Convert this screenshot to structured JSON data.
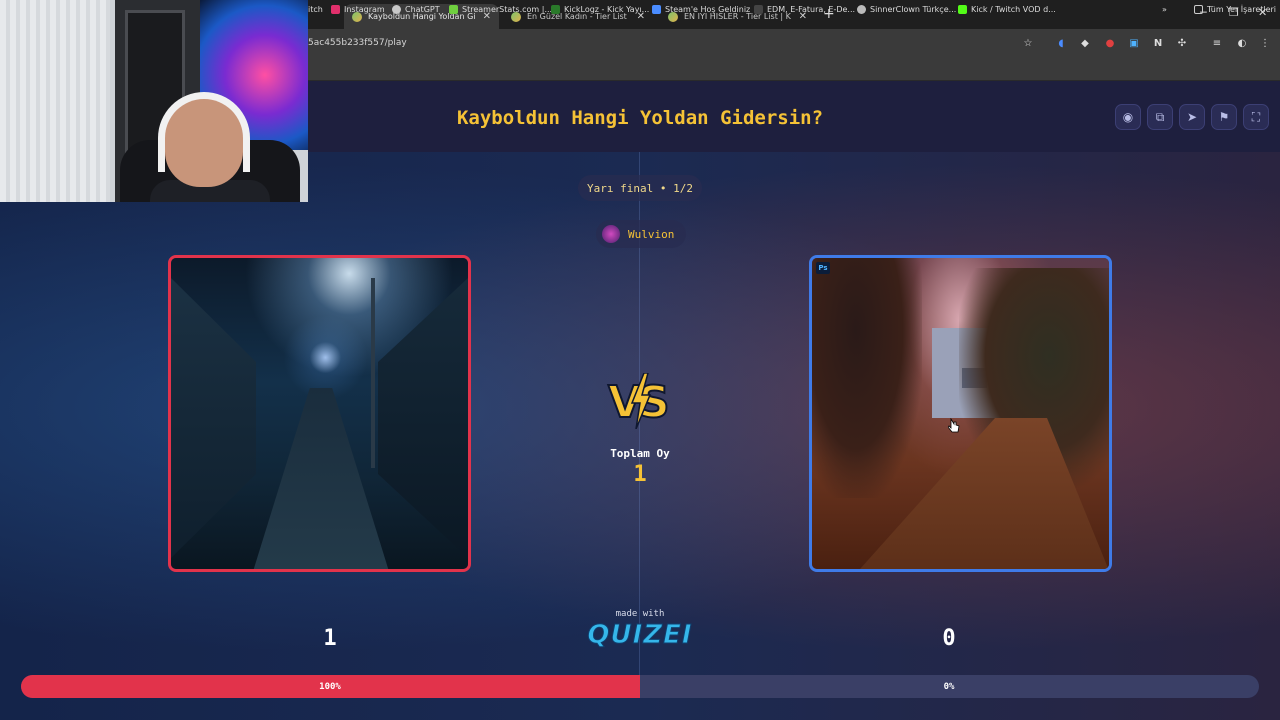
{
  "browser": {
    "tabs": [
      {
        "label": "Kayboldun Hangi Yoldan Giders",
        "active": true
      },
      {
        "label": "En Güzel Kadın - Tier List | Kör S",
        "active": false
      },
      {
        "label": "EN IYI HISLER - Tier List | Kör Sı",
        "active": false
      }
    ],
    "url": "5ac455b233f557/play",
    "bookmarks": [
      "itch",
      "Instagram",
      "ChatGPT",
      "StreamerStats.com |...",
      "KickLogz - Kick Yayı...",
      "Steam'e Hoş Geldiniz",
      "EDM, E-Fatura, E-De...",
      "SinnerClown Türkçe...",
      "Kick / Twitch VOD d..."
    ],
    "all_bookmarks_label": "Tüm Yer İşaretleri"
  },
  "header": {
    "title": "Kayboldun Hangi Yoldan Gidersin?"
  },
  "round": {
    "label": "Yarı final • 1/2",
    "username": "Wulvion"
  },
  "center": {
    "vs_label": "VS",
    "total_label": "Toplam Oy",
    "total_value": "1"
  },
  "left": {
    "votes": "1",
    "percent_label": "100%",
    "percent": 100,
    "border_color": "#e2334b"
  },
  "right": {
    "votes": "0",
    "percent_label": "0%",
    "percent": 0,
    "badge": "Ps",
    "border_color": "#3f7be8"
  },
  "footer": {
    "made_with": "made with",
    "brand": "QUIZEI"
  },
  "colors": {
    "accent": "#f5c236",
    "header_bg": "#1e1f3e"
  }
}
